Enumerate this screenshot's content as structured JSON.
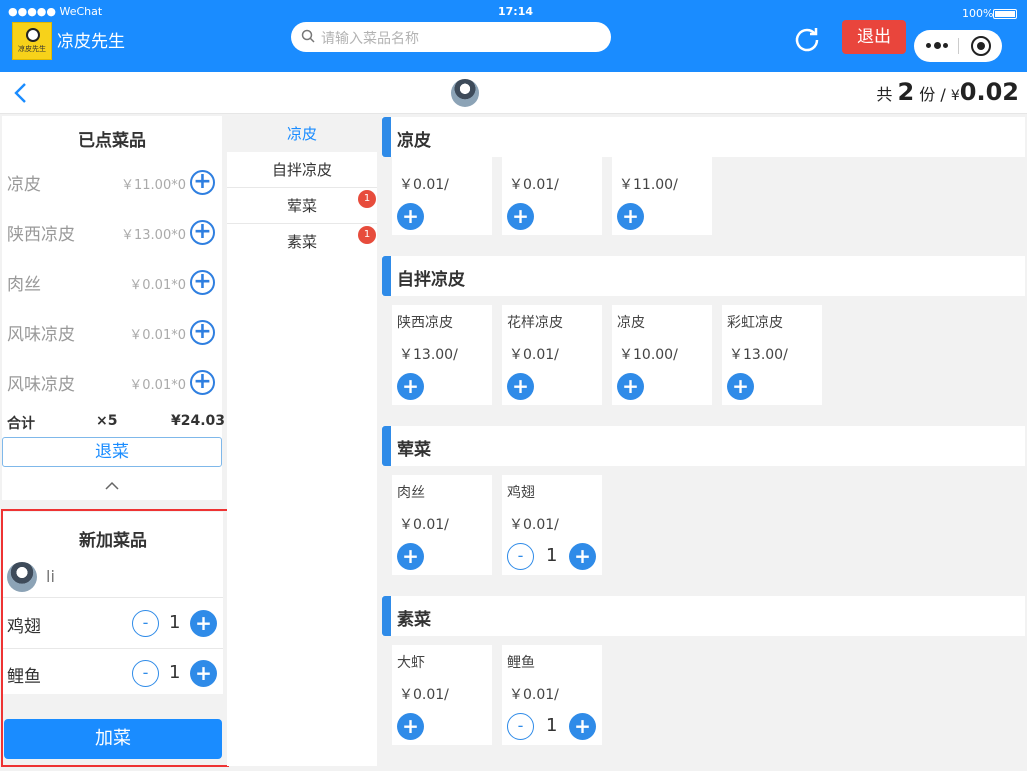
{
  "status": {
    "carrier": "●●●●● WeChat",
    "time": "17:14",
    "battery": "100%"
  },
  "app": {
    "name": "凉皮先生",
    "logo_text": "凉皮先生"
  },
  "search": {
    "placeholder": "请输入菜品名称"
  },
  "header": {
    "logout_label": "退出"
  },
  "summary": {
    "prefix": "共",
    "count": "2",
    "unit": "份",
    "sep": "/",
    "currency": "¥",
    "amount": "0.02"
  },
  "ordered": {
    "title": "已点菜品",
    "items": [
      {
        "name": "凉皮",
        "price": "￥11.00*0"
      },
      {
        "name": "陕西凉皮",
        "price": "￥13.00*0"
      },
      {
        "name": "肉丝",
        "price": "￥0.01*0"
      },
      {
        "name": "风味凉皮",
        "price": "￥0.01*0"
      },
      {
        "name": "风味凉皮",
        "price": "￥0.01*0"
      }
    ],
    "total_label": "合计",
    "total_count": "×5",
    "total_amount": "¥24.03",
    "refund_label": "退菜"
  },
  "new_dishes": {
    "title": "新加菜品",
    "user": "li",
    "items": [
      {
        "name": "鸡翅",
        "qty": "1"
      },
      {
        "name": "鲤鱼",
        "qty": "1"
      }
    ],
    "add_label": "加菜"
  },
  "categories": [
    {
      "name": "凉皮",
      "badge": ""
    },
    {
      "name": "自拌凉皮",
      "badge": ""
    },
    {
      "name": "荤菜",
      "badge": "1"
    },
    {
      "name": "素菜",
      "badge": "1"
    }
  ],
  "sections": [
    {
      "title": "凉皮",
      "dishes": [
        {
          "name": "",
          "price": "￥0.01/"
        },
        {
          "name": "",
          "price": "￥0.01/"
        },
        {
          "name": "",
          "price": "￥11.00/"
        }
      ]
    },
    {
      "title": "自拌凉皮",
      "dishes": [
        {
          "name": "陕西凉皮",
          "price": "￥13.00/"
        },
        {
          "name": "花样凉皮",
          "price": "￥0.01/"
        },
        {
          "name": "凉皮",
          "price": "￥10.00/"
        },
        {
          "name": "彩虹凉皮",
          "price": "￥13.00/"
        }
      ]
    },
    {
      "title": "荤菜",
      "dishes": [
        {
          "name": "肉丝",
          "price": "￥0.01/"
        },
        {
          "name": "鸡翅",
          "price": "￥0.01/",
          "qty": "1"
        }
      ]
    },
    {
      "title": "素菜",
      "dishes": [
        {
          "name": "大虾",
          "price": "￥0.01/"
        },
        {
          "name": "鲤鱼",
          "price": "￥0.01/",
          "qty": "1"
        }
      ]
    }
  ],
  "icons": {
    "plus": "+",
    "minus": "-",
    "collapse": "chevron-up-icon",
    "back": "chevron-left-icon",
    "refresh": "refresh-icon",
    "menu": "more-icon",
    "close": "target-icon",
    "search": "search-icon"
  },
  "colors": {
    "primary": "#1a8cff",
    "danger": "#e9453c",
    "badge": "#e74c3c"
  }
}
